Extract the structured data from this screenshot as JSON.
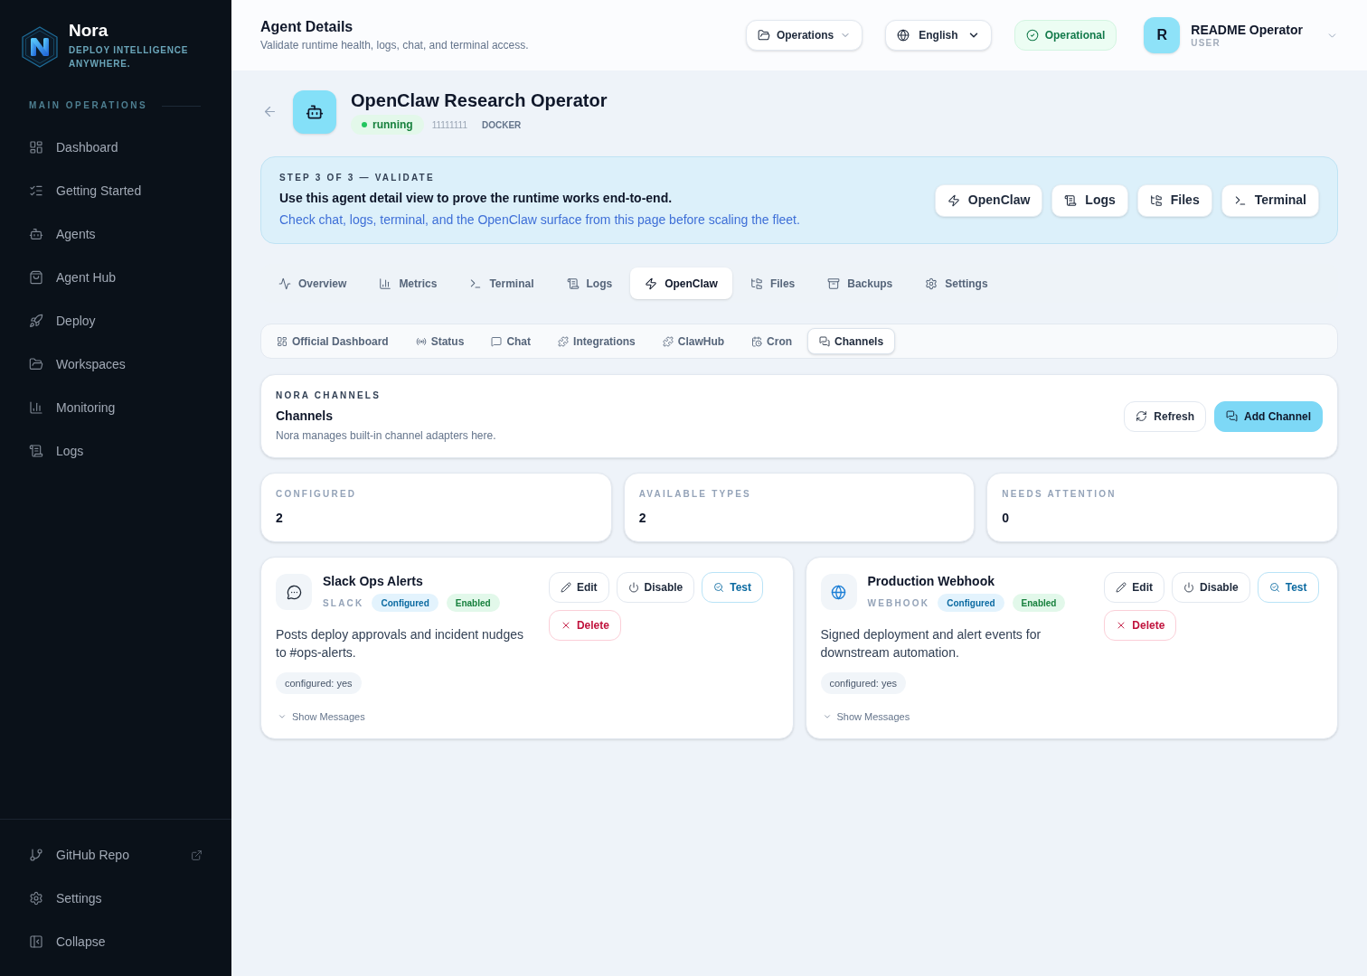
{
  "sidebar": {
    "brand": {
      "name": "Nora",
      "tagline": "DEPLOY INTELLIGENCE ANYWHERE."
    },
    "section_label": "MAIN OPERATIONS",
    "items": [
      {
        "label": "Dashboard",
        "selected": false
      },
      {
        "label": "Getting Started",
        "selected": false
      },
      {
        "label": "Agents",
        "selected": false
      },
      {
        "label": "Agent Hub",
        "selected": false
      },
      {
        "label": "Deploy",
        "selected": false
      },
      {
        "label": "Workspaces",
        "selected": false
      },
      {
        "label": "Monitoring",
        "selected": false
      },
      {
        "label": "Logs",
        "selected": false
      }
    ],
    "footer_items": [
      {
        "label": "GitHub Repo",
        "external": true
      },
      {
        "label": "Settings",
        "external": false
      },
      {
        "label": "Collapse",
        "external": false
      }
    ]
  },
  "header": {
    "title": "Agent Details",
    "subtitle": "Validate runtime health, logs, chat, and terminal access.",
    "workspace": "Operations",
    "language": "English",
    "status": "Operational",
    "user": {
      "initial": "R",
      "name": "README Operator",
      "role": "USER"
    }
  },
  "agent": {
    "name": "OpenClaw Research Operator",
    "status": "running",
    "id": "11111111",
    "runtime": "DOCKER"
  },
  "step_banner": {
    "step": "STEP 3 OF 3 — VALIDATE",
    "heading": "Use this agent detail view to prove the runtime works end-to-end.",
    "text": "Check chat, logs, terminal, and the OpenClaw surface from this page before scaling the fleet.",
    "buttons": [
      "OpenClaw",
      "Logs",
      "Files",
      "Terminal"
    ]
  },
  "tabs": [
    {
      "label": "Overview",
      "selected": false
    },
    {
      "label": "Metrics",
      "selected": false
    },
    {
      "label": "Terminal",
      "selected": false
    },
    {
      "label": "Logs",
      "selected": false
    },
    {
      "label": "OpenClaw",
      "selected": true
    },
    {
      "label": "Files",
      "selected": false
    },
    {
      "label": "Backups",
      "selected": false
    },
    {
      "label": "Settings",
      "selected": false
    }
  ],
  "subtabs": [
    {
      "label": "Official Dashboard",
      "selected": false
    },
    {
      "label": "Status",
      "selected": false
    },
    {
      "label": "Chat",
      "selected": false
    },
    {
      "label": "Integrations",
      "selected": false
    },
    {
      "label": "ClawHub",
      "selected": false
    },
    {
      "label": "Cron",
      "selected": false
    },
    {
      "label": "Channels",
      "selected": true
    }
  ],
  "channels_panel": {
    "eyebrow": "NORA CHANNELS",
    "title": "Channels",
    "description": "Nora manages built-in channel adapters here.",
    "buttons": [
      {
        "label": "Refresh",
        "kind": "secondary"
      },
      {
        "label": "Add Channel",
        "kind": "primary"
      }
    ]
  },
  "stats": [
    {
      "label": "CONFIGURED",
      "value": "2"
    },
    {
      "label": "AVAILABLE TYPES",
      "value": "2"
    },
    {
      "label": "NEEDS ATTENTION",
      "value": "0"
    }
  ],
  "channel_cards": [
    {
      "name": "Slack Ops Alerts",
      "type": "SLACK",
      "badges": [
        {
          "label": "Configured",
          "kind": "info"
        },
        {
          "label": "Enabled",
          "kind": "success"
        }
      ],
      "actions": [
        {
          "label": "Edit",
          "kind": "default"
        },
        {
          "label": "Disable",
          "kind": "default"
        },
        {
          "label": "Test",
          "kind": "accent"
        },
        {
          "label": "Delete",
          "kind": "danger"
        }
      ],
      "description": "Posts deploy approvals and incident nudges to #ops-alerts.",
      "meta": "configured: yes",
      "toggle": {
        "label": "Show Messages",
        "expanded": false
      }
    },
    {
      "name": "Production Webhook",
      "type": "WEBHOOK",
      "badges": [
        {
          "label": "Configured",
          "kind": "info"
        },
        {
          "label": "Enabled",
          "kind": "success"
        }
      ],
      "actions": [
        {
          "label": "Edit",
          "kind": "default"
        },
        {
          "label": "Disable",
          "kind": "default"
        },
        {
          "label": "Test",
          "kind": "accent"
        },
        {
          "label": "Delete",
          "kind": "danger"
        }
      ],
      "description": "Signed deployment and alert events for downstream automation.",
      "meta": "configured: yes",
      "toggle": {
        "label": "Show Messages",
        "expanded": false
      }
    }
  ]
}
